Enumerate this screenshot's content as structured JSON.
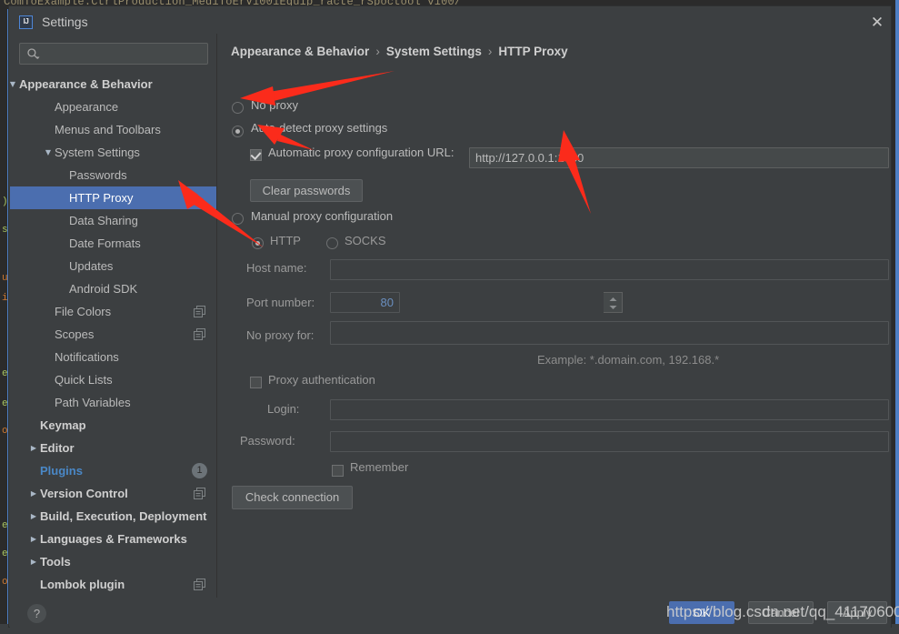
{
  "background": {
    "top_code_line": "ComToExample.CtrlProduction_MediToErV1001Equip_racte_rSpoctool v100/"
  },
  "window": {
    "title": "Settings",
    "logo_text": "IJ",
    "close_icon": "close-icon"
  },
  "search": {
    "placeholder": "",
    "value": "",
    "icon": "search-icon"
  },
  "sidebar": {
    "items": [
      {
        "label": "Appearance & Behavior",
        "indent": 10,
        "arrow": "▼",
        "bold": true,
        "selected": false,
        "copy": false,
        "badge": null
      },
      {
        "label": "Appearance",
        "indent": 49,
        "arrow": "",
        "bold": false,
        "selected": false,
        "copy": false,
        "badge": null
      },
      {
        "label": "Menus and Toolbars",
        "indent": 49,
        "arrow": "",
        "bold": false,
        "selected": false,
        "copy": false,
        "badge": null
      },
      {
        "label": "System Settings",
        "indent": 49,
        "arrow": "▼",
        "bold": false,
        "selected": false,
        "copy": false,
        "badge": null
      },
      {
        "label": "Passwords",
        "indent": 65,
        "arrow": "",
        "bold": false,
        "selected": false,
        "copy": false,
        "badge": null
      },
      {
        "label": "HTTP Proxy",
        "indent": 65,
        "arrow": "",
        "bold": false,
        "selected": true,
        "copy": false,
        "badge": null
      },
      {
        "label": "Data Sharing",
        "indent": 65,
        "arrow": "",
        "bold": false,
        "selected": false,
        "copy": false,
        "badge": null
      },
      {
        "label": "Date Formats",
        "indent": 65,
        "arrow": "",
        "bold": false,
        "selected": false,
        "copy": false,
        "badge": null
      },
      {
        "label": "Updates",
        "indent": 65,
        "arrow": "",
        "bold": false,
        "selected": false,
        "copy": false,
        "badge": null
      },
      {
        "label": "Android SDK",
        "indent": 65,
        "arrow": "",
        "bold": false,
        "selected": false,
        "copy": false,
        "badge": null
      },
      {
        "label": "File Colors",
        "indent": 49,
        "arrow": "",
        "bold": false,
        "selected": false,
        "copy": true,
        "badge": null
      },
      {
        "label": "Scopes",
        "indent": 49,
        "arrow": "",
        "bold": false,
        "selected": false,
        "copy": true,
        "badge": null
      },
      {
        "label": "Notifications",
        "indent": 49,
        "arrow": "",
        "bold": false,
        "selected": false,
        "copy": false,
        "badge": null
      },
      {
        "label": "Quick Lists",
        "indent": 49,
        "arrow": "",
        "bold": false,
        "selected": false,
        "copy": false,
        "badge": null
      },
      {
        "label": "Path Variables",
        "indent": 49,
        "arrow": "",
        "bold": false,
        "selected": false,
        "copy": false,
        "badge": null
      },
      {
        "label": "Keymap",
        "indent": 33,
        "arrow": "",
        "bold": true,
        "selected": false,
        "copy": false,
        "badge": null
      },
      {
        "label": "Editor",
        "indent": 33,
        "arrow": "▶",
        "bold": true,
        "selected": false,
        "copy": false,
        "badge": null
      },
      {
        "label": "Plugins",
        "indent": 33,
        "arrow": "",
        "bold": true,
        "selected": false,
        "copy": false,
        "badge": "1",
        "accent": true
      },
      {
        "label": "Version Control",
        "indent": 33,
        "arrow": "▶",
        "bold": true,
        "selected": false,
        "copy": true,
        "badge": null
      },
      {
        "label": "Build, Execution, Deployment",
        "indent": 33,
        "arrow": "▶",
        "bold": true,
        "selected": false,
        "copy": false,
        "badge": null
      },
      {
        "label": "Languages & Frameworks",
        "indent": 33,
        "arrow": "▶",
        "bold": true,
        "selected": false,
        "copy": false,
        "badge": null
      },
      {
        "label": "Tools",
        "indent": 33,
        "arrow": "▶",
        "bold": true,
        "selected": false,
        "copy": false,
        "badge": null
      },
      {
        "label": "Lombok plugin",
        "indent": 33,
        "arrow": "",
        "bold": true,
        "selected": false,
        "copy": true,
        "badge": null
      }
    ]
  },
  "breadcrumb": {
    "part1": "Appearance & Behavior",
    "sep1": "›",
    "part2": "System Settings",
    "sep2": "›",
    "part3": "HTTP Proxy"
  },
  "proxy": {
    "no_proxy_label": "No proxy",
    "no_proxy_selected": false,
    "auto_detect_label": "Auto-detect proxy settings",
    "auto_detect_selected": true,
    "auto_url_checkbox_label": "Automatic proxy configuration URL:",
    "auto_url_checked": true,
    "auto_url_value": "http://127.0.0.1:1080",
    "clear_passwords_label": "Clear passwords",
    "manual_label": "Manual proxy configuration",
    "manual_selected": false,
    "http_label": "HTTP",
    "http_selected": true,
    "socks_label": "SOCKS",
    "socks_selected": false,
    "host_name_label": "Host name:",
    "host_name_value": "",
    "port_number_label": "Port number:",
    "port_number_value": "80",
    "no_proxy_for_label": "No proxy for:",
    "no_proxy_for_value": "",
    "expand_icon": "expand-icon",
    "example_text": "Example: *.domain.com, 192.168.*",
    "proxy_auth_label": "Proxy authentication",
    "proxy_auth_checked": false,
    "login_label": "Login:",
    "login_value": "",
    "password_label": "Password:",
    "password_value": "",
    "remember_label": "Remember",
    "remember_checked": false,
    "check_connection_label": "Check connection"
  },
  "footer": {
    "help_label": "?",
    "ok_label": "OK",
    "cancel_label": "Cancel",
    "apply_label": "Apply"
  },
  "watermark": {
    "text": "https://blog.csdn.net/qq_41170600"
  },
  "colors": {
    "dialog_bg": "#3c3f41",
    "selection_blue": "#4b6eaf",
    "accent_link": "#4a88c7",
    "arrow_red": "#ff2d1e",
    "field_bg": "#45494a"
  }
}
